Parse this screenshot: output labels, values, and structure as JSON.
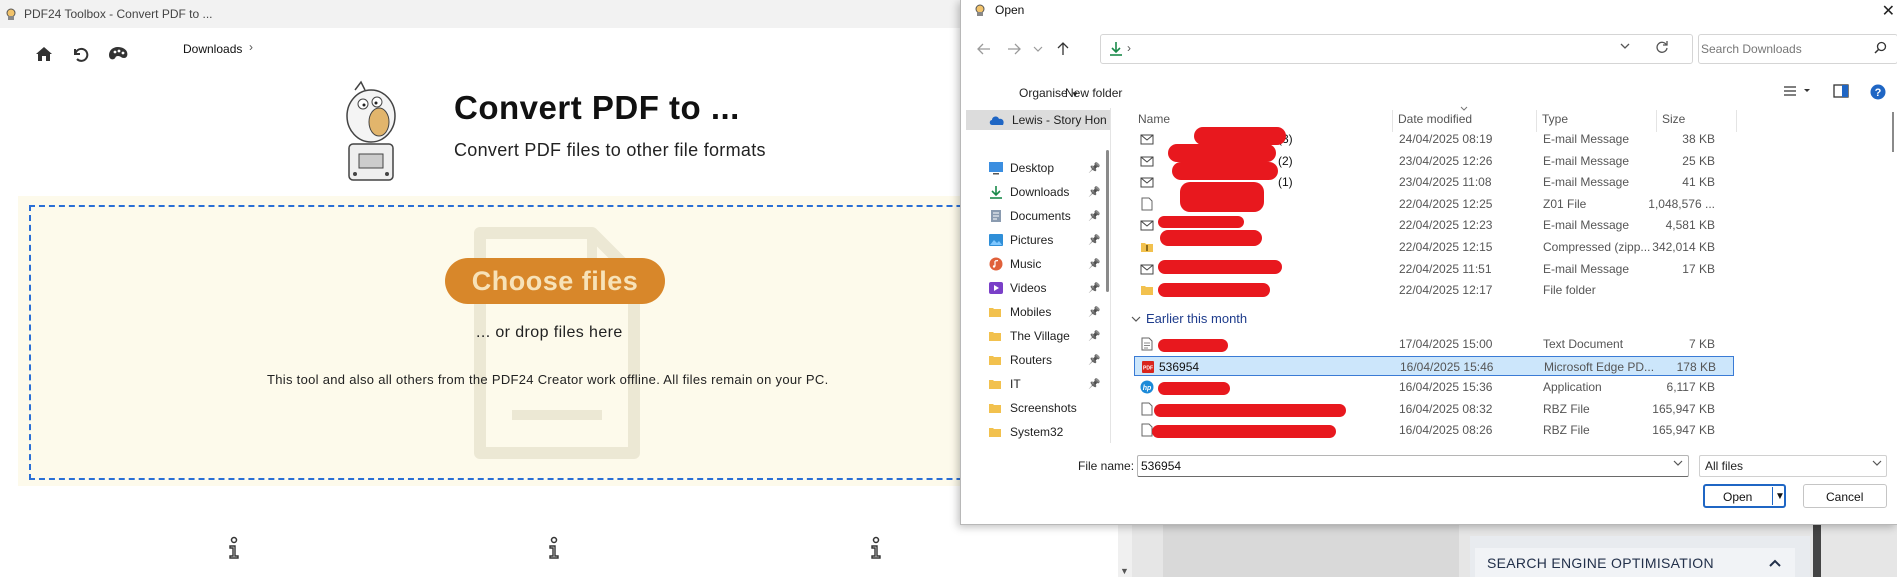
{
  "pdf24": {
    "window_title": "PDF24 Toolbox - Convert PDF to ...",
    "toolbar_icons": [
      "home-icon",
      "undo-icon",
      "palette-icon"
    ],
    "hero_title": "Convert PDF to ...",
    "hero_subtitle": "Convert PDF files to other file formats",
    "choose_files": "Choose files",
    "drop_hint": "... or drop files here",
    "offline_note": "This tool and also all others from the PDF24 Creator work offline. All files remain on your PC.",
    "accent_color": "#d8872a",
    "dropzone_border": "#2a6fd6",
    "dropzone_bg": "#fdfaeb"
  },
  "background_page": {
    "section_heading": "SEARCH ENGINE OPTIMISATION"
  },
  "dialog": {
    "title": "Open",
    "breadcrumb": "Downloads",
    "search_placeholder": "Search Downloads",
    "organise": "Organise",
    "new_folder": "New folder",
    "nav": {
      "onedrive": "Lewis - Story Hon",
      "items": [
        {
          "label": "Desktop",
          "icon": "desktop-icon",
          "pinned": true
        },
        {
          "label": "Downloads",
          "icon": "download-icon",
          "pinned": true
        },
        {
          "label": "Documents",
          "icon": "documents-icon",
          "pinned": true
        },
        {
          "label": "Pictures",
          "icon": "pictures-icon",
          "pinned": true
        },
        {
          "label": "Music",
          "icon": "music-icon",
          "pinned": true
        },
        {
          "label": "Videos",
          "icon": "videos-icon",
          "pinned": true
        },
        {
          "label": "Mobiles",
          "icon": "folder-icon",
          "pinned": true
        },
        {
          "label": "The Village",
          "icon": "folder-icon",
          "pinned": true
        },
        {
          "label": "Routers",
          "icon": "folder-icon",
          "pinned": true
        },
        {
          "label": "IT",
          "icon": "folder-icon",
          "pinned": true
        },
        {
          "label": "Screenshots",
          "icon": "folder-icon",
          "pinned": false
        },
        {
          "label": "System32",
          "icon": "folder-icon",
          "pinned": false
        }
      ]
    },
    "columns": {
      "name": "Name",
      "date": "Date modified",
      "type": "Type",
      "size": "Size"
    },
    "files_recent": [
      {
        "name": "(3)",
        "date": "24/04/2025 08:19",
        "type": "E-mail Message",
        "size": "38 KB",
        "icon": "mail-icon"
      },
      {
        "name": "(2)",
        "date": "23/04/2025 12:26",
        "type": "E-mail Message",
        "size": "25 KB",
        "icon": "mail-icon"
      },
      {
        "name": "(1)",
        "date": "23/04/2025 11:08",
        "type": "E-mail Message",
        "size": "41 KB",
        "icon": "mail-icon"
      },
      {
        "name": "",
        "date": "22/04/2025 12:25",
        "type": "Z01 File",
        "size": "1,048,576 ...",
        "icon": "file-icon"
      },
      {
        "name": "",
        "date": "22/04/2025 12:23",
        "type": "E-mail Message",
        "size": "4,581 KB",
        "icon": "mail-icon"
      },
      {
        "name": "",
        "date": "22/04/2025 12:15",
        "type": "Compressed (zipp...",
        "size": "342,014 KB",
        "icon": "zip-folder-icon"
      },
      {
        "name": "",
        "date": "22/04/2025 11:51",
        "type": "E-mail Message",
        "size": "17 KB",
        "icon": "mail-icon"
      },
      {
        "name": "",
        "date": "22/04/2025 12:17",
        "type": "File folder",
        "size": "",
        "icon": "folder-icon"
      }
    ],
    "group_earlier": "Earlier this month",
    "files_earlier": [
      {
        "name": "",
        "date": "17/04/2025 15:00",
        "type": "Text Document",
        "size": "7 KB",
        "icon": "text-file-icon"
      },
      {
        "name": "536954",
        "date": "16/04/2025 15:46",
        "type": "Microsoft Edge PD...",
        "size": "178 KB",
        "icon": "pdf-icon"
      },
      {
        "name": "",
        "date": "16/04/2025 15:36",
        "type": "Application",
        "size": "6,117 KB",
        "icon": "hp-icon"
      },
      {
        "name": "",
        "date": "16/04/2025 08:32",
        "type": "RBZ File",
        "size": "165,947 KB",
        "icon": "file-icon"
      },
      {
        "name": "",
        "date": "16/04/2025 08:26",
        "type": "RBZ File",
        "size": "165,947 KB",
        "icon": "file-icon"
      }
    ],
    "file_name_label": "File name:",
    "file_name_value": "536954",
    "file_type_value": "All files",
    "open": "Open",
    "cancel": "Cancel",
    "selection_color": "#cce6fb",
    "redaction_color": "#e8181e"
  }
}
